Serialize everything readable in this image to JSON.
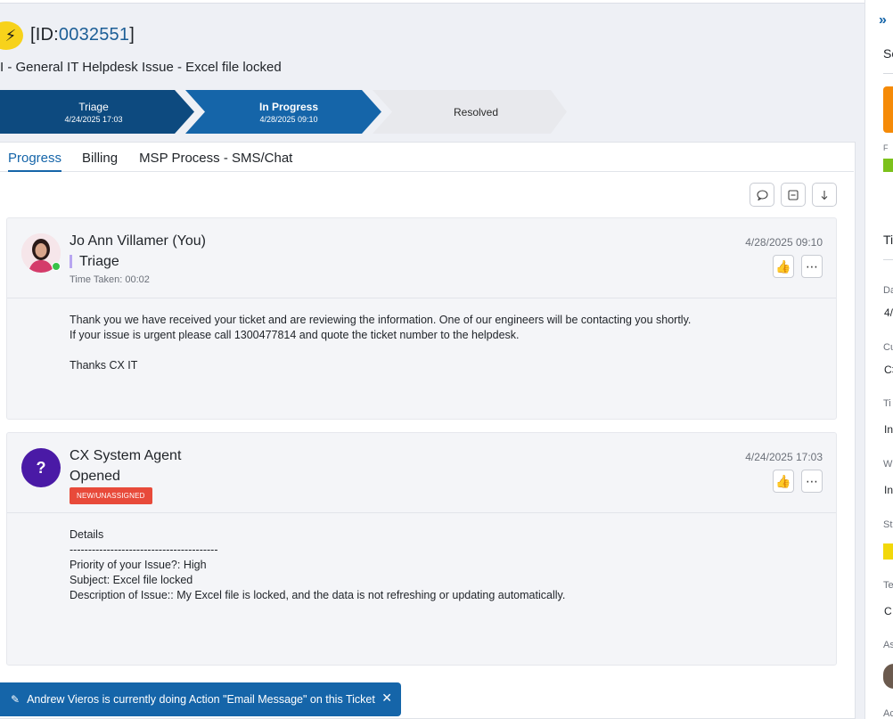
{
  "ticket": {
    "id_prefix": "[ID:",
    "id_number": "0032551",
    "id_suffix": "]",
    "title": "I - General IT Helpdesk Issue - Excel file locked"
  },
  "stages": [
    {
      "name": "Triage",
      "date": "4/24/2025 17:03"
    },
    {
      "name": "In Progress",
      "date": "4/28/2025 09:10"
    },
    {
      "name": "Resolved",
      "date": ""
    }
  ],
  "tabs": [
    {
      "label": "Progress"
    },
    {
      "label": "Billing"
    },
    {
      "label": "MSP Process - SMS/Chat"
    }
  ],
  "activities": [
    {
      "author": "Jo Ann Villamer (You)",
      "stage": "Triage",
      "time_taken": "Time Taken: 00:02",
      "timestamp": "4/28/2025 09:10",
      "body": [
        "Thank you we have received your ticket and are reviewing the information. One of our engineers will be contacting you shortly.",
        "If your issue is urgent please call 1300477814 and quote the ticket number to the helpdesk.",
        "",
        "Thanks CX IT"
      ]
    },
    {
      "author": "CX System Agent",
      "avatar_char": "?",
      "stage": "Opened",
      "badge": "NEW/UNASSIGNED",
      "timestamp": "4/24/2025 17:03",
      "body": [
        "Details",
        "----------------------------------------",
        "Priority of your Issue?: High",
        "Subject: Excel file locked",
        "Description of Issue:: My Excel file is locked, and the data is not refreshing or updating automatically."
      ]
    }
  ],
  "toolbar_icons": [
    "comment-icon",
    "collapse-icon",
    "sort-down-icon"
  ],
  "notification": {
    "text": "Andrew Vieros is currently doing Action \"Email Message\" on this Ticket"
  },
  "right_panel": {
    "header_1": "Sc",
    "header_2": "Ti",
    "field_labels": [
      "Da",
      "Cu",
      "Ti",
      "W",
      "St",
      "Te",
      "As",
      "Ac"
    ],
    "field_values": [
      "4/",
      "C>",
      "In",
      "In",
      "",
      "C"
    ],
    "tiny_label": "F"
  },
  "colors": {
    "primary": "#1565a9",
    "dark_stage": "#0d4a7f",
    "badge_red": "#e84a3a",
    "ticket_yellow": "#f7d21b",
    "orange": "#f58a07",
    "green": "#7cc11b"
  }
}
